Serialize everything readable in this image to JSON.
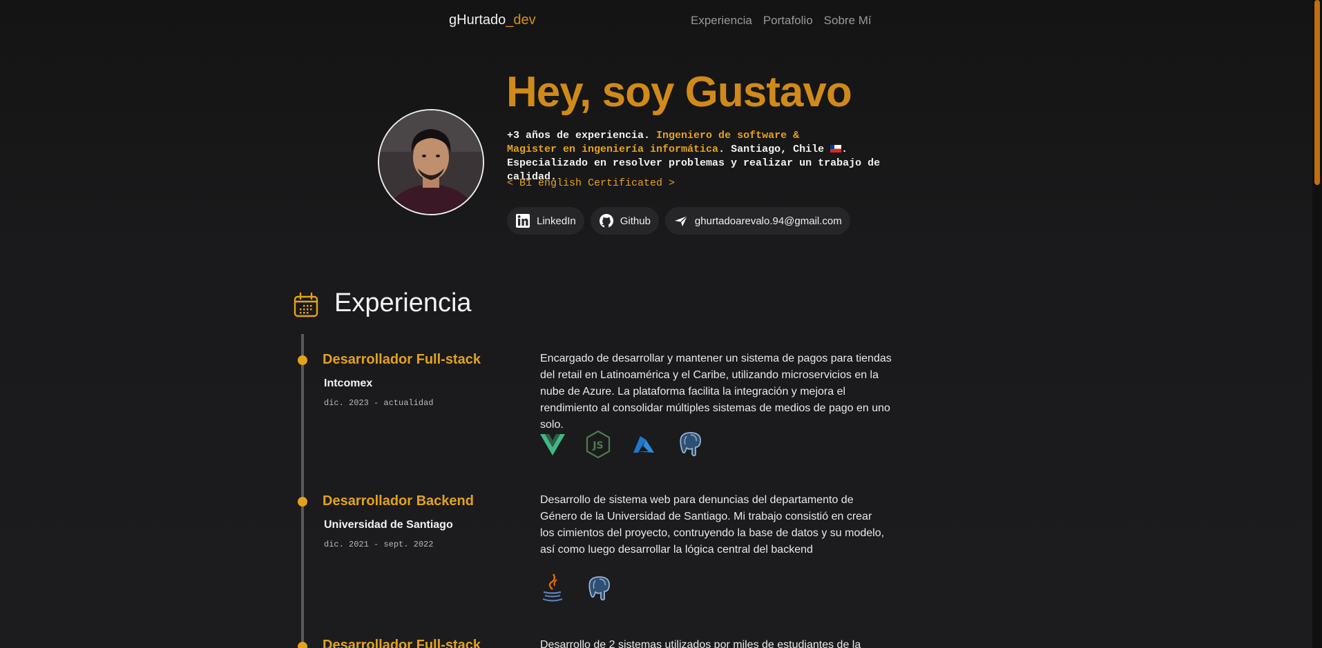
{
  "header": {
    "brand_main": "gHurtado",
    "brand_accent": "_dev",
    "nav": [
      {
        "label": "Experiencia"
      },
      {
        "label": "Portafolio"
      },
      {
        "label": "Sobre Mí"
      }
    ]
  },
  "hero": {
    "title": "Hey, soy Gustavo",
    "line1_plain": "+3 años de experiencia. ",
    "line1_highlight": "Ingeniero de software &",
    "line2_highlight": "Magister en ingeniería informática",
    "line2_plain": ". Santiago, Chile ",
    "line2_end": ".",
    "line3": "Especializado en resolver problemas y realizar un trabajo de calidad.",
    "certificate": "< B1 english Certificated >",
    "social": [
      {
        "label": "LinkedIn",
        "icon": "linkedin-icon"
      },
      {
        "label": "Github",
        "icon": "github-icon"
      },
      {
        "label": "ghurtadoarevalo.94@gmail.com",
        "icon": "send-icon"
      }
    ]
  },
  "experience": {
    "title": "Experiencia",
    "icon": "calendar-icon",
    "jobs": [
      {
        "role": "Desarrollador Full-stack",
        "company": "Intcomex",
        "dates": "dic. 2023 - actualidad",
        "description": "Encargado de desarrollar y mantener un sistema de pagos para tiendas del retail en Latinoamérica y el Caribe, utilizando microservicios en la nube de Azure. La plataforma facilita la integración y mejora el rendimiento al consolidar múltiples sistemas de medios de pago en uno solo.",
        "techs": [
          "vue-icon",
          "nodejs-icon",
          "azure-icon",
          "postgresql-icon"
        ]
      },
      {
        "role": "Desarrollador Backend",
        "company": "Universidad de Santiago",
        "dates": "dic. 2021 - sept. 2022",
        "description": "Desarrollo de sistema web para denuncias del departamento de Género de la Universidad de Santiago. Mi trabajo consistió en crear los cimientos del proyecto, contruyendo la base de datos y su modelo, así como luego desarrollar la lógica central del backend",
        "techs": [
          "java-icon",
          "postgresql-icon"
        ]
      },
      {
        "role": "Desarrollador Full-stack",
        "description": "Desarrollo de 2 sistemas utilizados por miles de estudiantes de la"
      }
    ]
  },
  "colors": {
    "accent": "#d08a1a",
    "accent_light": "#e3a21c",
    "background": "#1a1a1c",
    "pill": "#262628"
  }
}
